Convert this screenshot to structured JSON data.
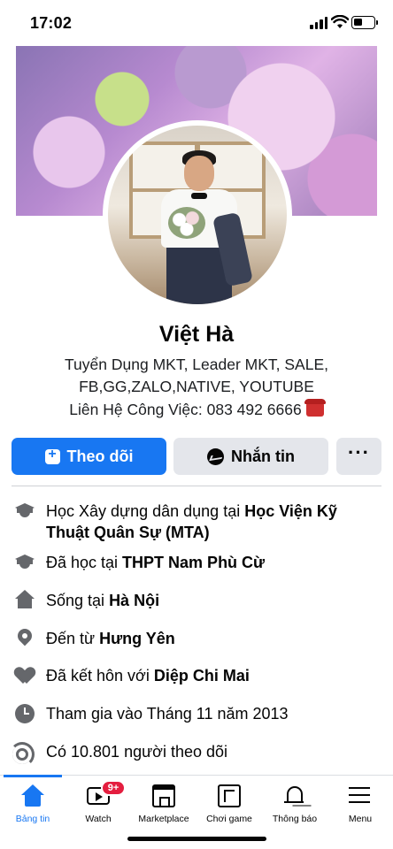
{
  "status": {
    "time": "17:02"
  },
  "profile": {
    "name": "Việt Hà",
    "bio_line1": "Tuyển Dụng MKT, Leader MKT, SALE,",
    "bio_line2": "FB,GG,ZALO,NATIVE, YOUTUBE",
    "contact": "Liên Hệ Công Việc: 083 492 6666"
  },
  "actions": {
    "follow": "Theo dõi",
    "message": "Nhắn tin",
    "more": "···"
  },
  "details": [
    {
      "icon": "graduation-cap-icon",
      "prefix": "Học Xây dựng dân dụng tại ",
      "bold": "Học Viện Kỹ Thuật Quân Sự (MTA)",
      "suffix": ""
    },
    {
      "icon": "graduation-cap-icon",
      "prefix": "Đã học tại ",
      "bold": "THPT Nam Phù Cừ",
      "suffix": ""
    },
    {
      "icon": "home-icon",
      "prefix": "Sống tại ",
      "bold": "Hà Nội",
      "suffix": ""
    },
    {
      "icon": "location-pin-icon",
      "prefix": "Đến từ ",
      "bold": "Hưng Yên",
      "suffix": ""
    },
    {
      "icon": "heart-icon",
      "prefix": "Đã kết hôn với ",
      "bold": "Diệp Chi Mai",
      "suffix": ""
    },
    {
      "icon": "clock-icon",
      "prefix": "Tham gia vào Tháng 11 năm 2013",
      "bold": "",
      "suffix": ""
    },
    {
      "icon": "rss-feed-icon",
      "prefix": "Có 10.801 người theo dõi",
      "bold": "",
      "suffix": ""
    }
  ],
  "tabbar": {
    "home": "Bảng tin",
    "watch": "Watch",
    "watch_badge": "9+",
    "marketplace": "Marketplace",
    "games": "Chơi game",
    "notifications": "Thông báo",
    "menu": "Menu"
  },
  "colors": {
    "accent": "#1877f2",
    "badge": "#e41e3f",
    "button_gray": "#e4e6eb",
    "icon_gray": "#65676b"
  }
}
